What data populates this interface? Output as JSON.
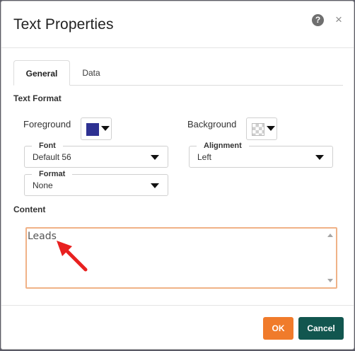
{
  "dialog": {
    "title": "Text Properties",
    "help_icon": "question-circle-icon",
    "help_glyph": "?",
    "close_icon": "close-icon",
    "close_glyph": "×"
  },
  "tabs": [
    {
      "label": "General",
      "active": true
    },
    {
      "label": "Data",
      "active": false
    }
  ],
  "text_format": {
    "section_label": "Text Format",
    "foreground_label": "Foreground",
    "foreground_color": "#2e3192",
    "background_label": "Background",
    "background_color": "transparent",
    "font": {
      "legend": "Font",
      "value": "Default 56"
    },
    "alignment": {
      "legend": "Alignment",
      "value": "Left"
    },
    "format": {
      "legend": "Format",
      "value": "None"
    }
  },
  "content": {
    "section_label": "Content",
    "value": "Leads",
    "pointer_color": "#e8201f"
  },
  "buttons": {
    "ok_label": "OK",
    "cancel_label": "Cancel",
    "ok_color": "#f07b2b",
    "cancel_color": "#12564f"
  }
}
